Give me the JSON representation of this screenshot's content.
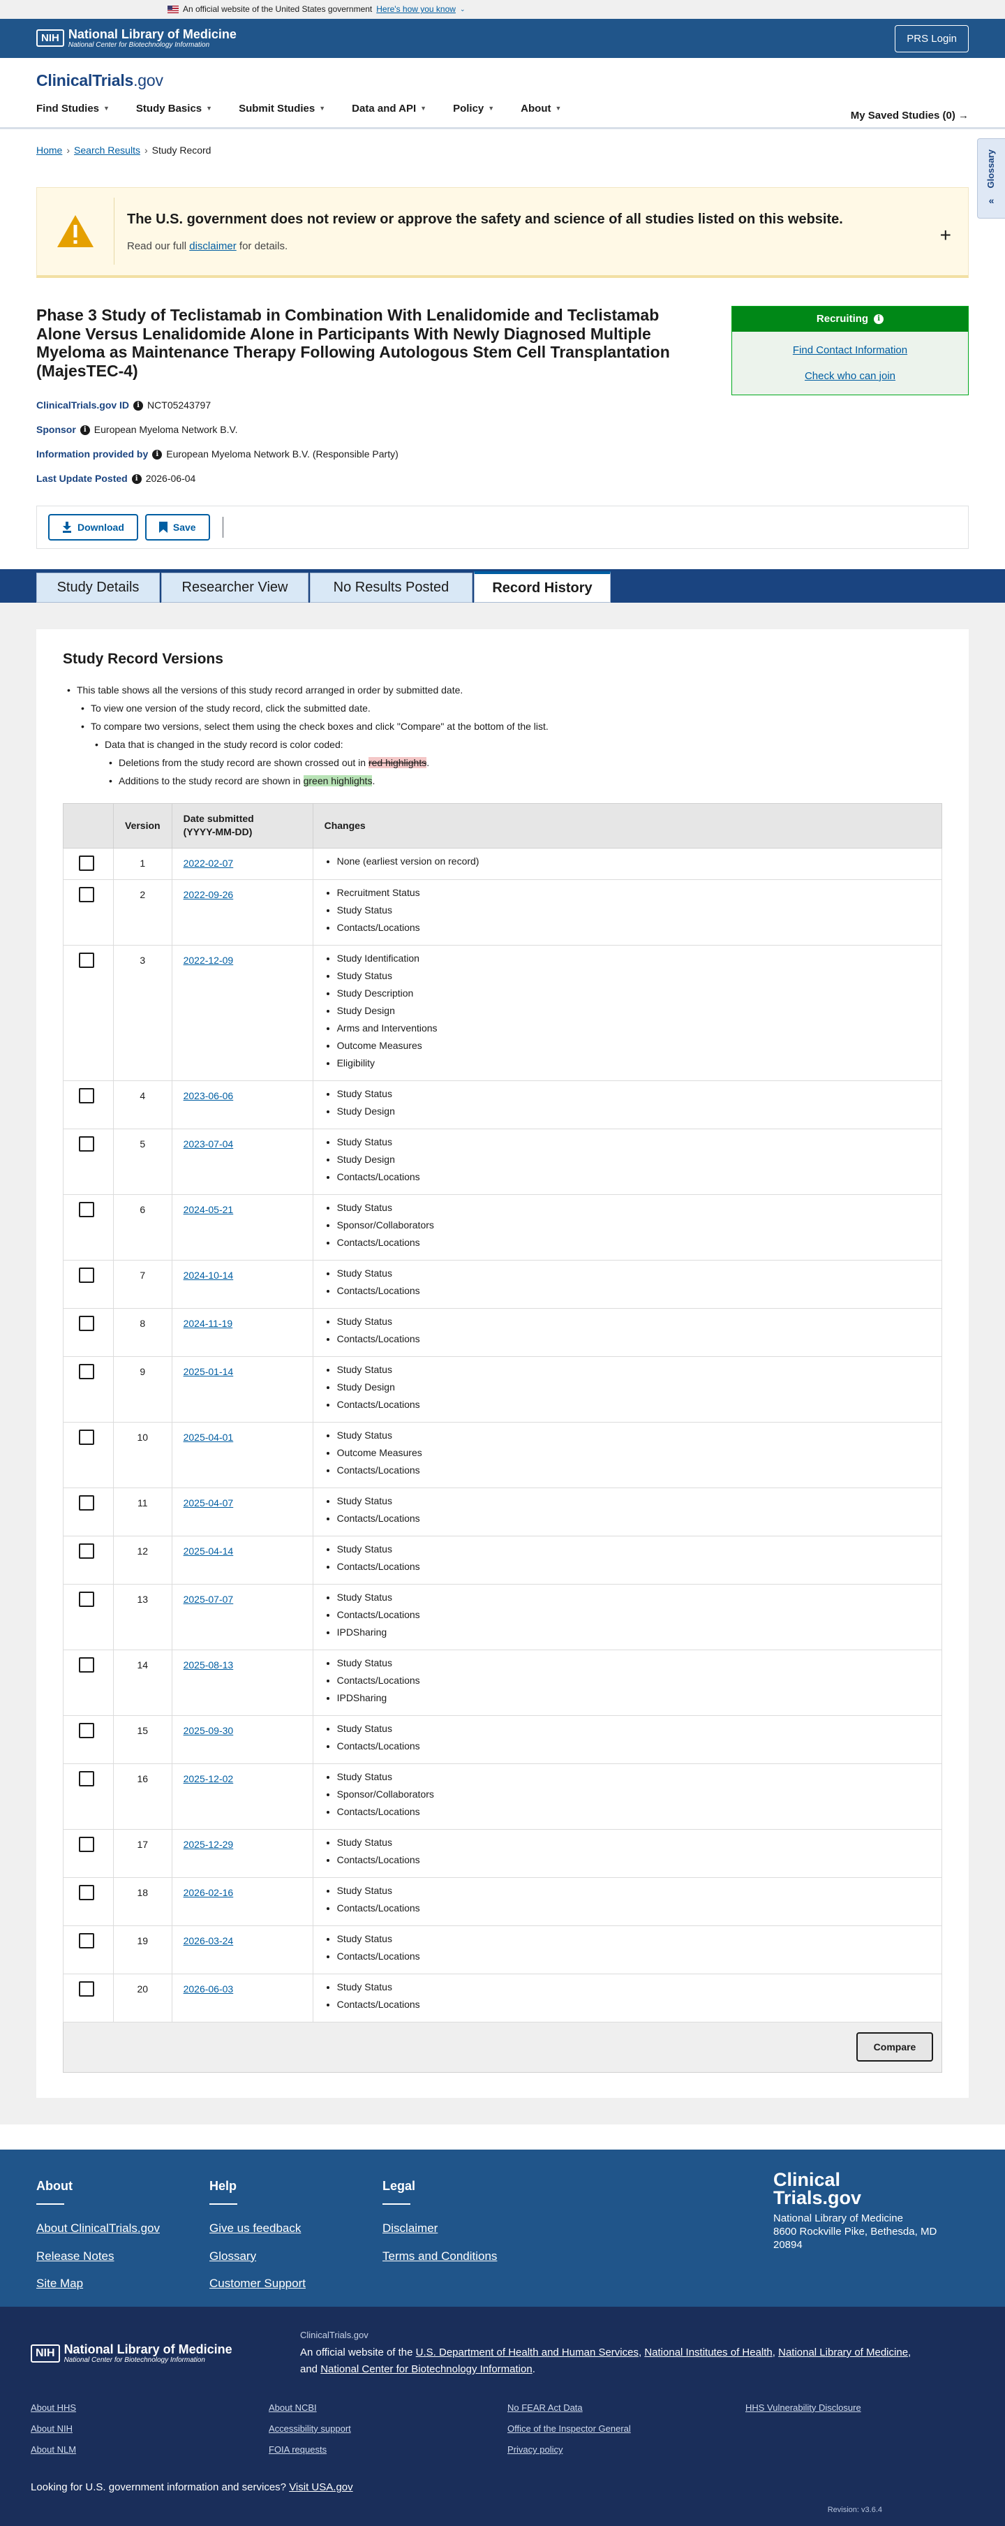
{
  "gov_banner": {
    "text": "An official website of the United States government",
    "link": "Here's how you know"
  },
  "nih_header": {
    "logo_box": "NIH",
    "org": "National Library of Medicine",
    "sub": "National Center for Biotechnology Information",
    "prs_login": "PRS Login"
  },
  "site": {
    "logo_main": "ClinicalTrials",
    "logo_suffix": ".gov",
    "nav": [
      "Find Studies",
      "Study Basics",
      "Submit Studies",
      "Data and API",
      "Policy",
      "About"
    ],
    "saved": "My Saved Studies (0)"
  },
  "glossary": "Glossary",
  "breadcrumb": {
    "home": "Home",
    "results": "Search Results",
    "current": "Study Record"
  },
  "alert": {
    "title": "The U.S. government does not review or approve the safety and science of all studies listed on this website.",
    "pre": "Read our full",
    "link": "disclaimer",
    "post": "for details."
  },
  "study": {
    "title": "Phase 3 Study of Teclistamab in Combination With Lenalidomide and Teclistamab Alone Versus Lenalidomide Alone in Participants With Newly Diagnosed Multiple Myeloma as Maintenance Therapy Following Autologous Stem Cell Transplantation (MajesTEC-4)",
    "id_label": "ClinicalTrials.gov ID",
    "id_value": "NCT05243797",
    "sponsor_label": "Sponsor",
    "sponsor_value": "European Myeloma Network B.V.",
    "info_label": "Information provided by",
    "info_value": "European Myeloma Network B.V. (Responsible Party)",
    "update_label": "Last Update Posted",
    "update_value": "2026-06-04"
  },
  "status": {
    "label": "Recruiting",
    "contact": "Find Contact Information",
    "join": "Check who can join"
  },
  "actions": {
    "download": "Download",
    "save": "Save"
  },
  "tabs": [
    "Study Details",
    "Researcher View",
    "No Results Posted",
    "Record History"
  ],
  "history": {
    "title": "Study Record Versions",
    "intro1": "This table shows all the versions of this study record arranged in order by submitted date.",
    "intro2": "To view one version of the study record, click the submitted date.",
    "intro3": "To compare two versions, select them using the check boxes and click \"Compare\" at the bottom of the list.",
    "intro4": "Data that is changed in the study record is color coded:",
    "del_pre": "Deletions from the study record are shown crossed out in",
    "del_hl": "red highlights",
    "add_pre": "Additions to the study record are shown in",
    "add_hl": "green highlights",
    "col_version": "Version",
    "col_date_1": "Date submitted",
    "col_date_2": "(YYYY-MM-DD)",
    "col_changes": "Changes",
    "compare": "Compare",
    "rows": [
      {
        "v": "1",
        "date": "2022-02-07",
        "changes": [
          "None (earliest version on record)"
        ]
      },
      {
        "v": "2",
        "date": "2022-09-26",
        "changes": [
          "Recruitment Status",
          "Study Status",
          "Contacts/Locations"
        ]
      },
      {
        "v": "3",
        "date": "2022-12-09",
        "changes": [
          "Study Identification",
          "Study Status",
          "Study Description",
          "Study Design",
          "Arms and Interventions",
          "Outcome Measures",
          "Eligibility"
        ]
      },
      {
        "v": "4",
        "date": "2023-06-06",
        "changes": [
          "Study Status",
          "Study Design"
        ]
      },
      {
        "v": "5",
        "date": "2023-07-04",
        "changes": [
          "Study Status",
          "Study Design",
          "Contacts/Locations"
        ]
      },
      {
        "v": "6",
        "date": "2024-05-21",
        "changes": [
          "Study Status",
          "Sponsor/Collaborators",
          "Contacts/Locations"
        ]
      },
      {
        "v": "7",
        "date": "2024-10-14",
        "changes": [
          "Study Status",
          "Contacts/Locations"
        ]
      },
      {
        "v": "8",
        "date": "2024-11-19",
        "changes": [
          "Study Status",
          "Contacts/Locations"
        ]
      },
      {
        "v": "9",
        "date": "2025-01-14",
        "changes": [
          "Study Status",
          "Study Design",
          "Contacts/Locations"
        ]
      },
      {
        "v": "10",
        "date": "2025-04-01",
        "changes": [
          "Study Status",
          "Outcome Measures",
          "Contacts/Locations"
        ]
      },
      {
        "v": "11",
        "date": "2025-04-07",
        "changes": [
          "Study Status",
          "Contacts/Locations"
        ]
      },
      {
        "v": "12",
        "date": "2025-04-14",
        "changes": [
          "Study Status",
          "Contacts/Locations"
        ]
      },
      {
        "v": "13",
        "date": "2025-07-07",
        "changes": [
          "Study Status",
          "Contacts/Locations",
          "IPDSharing"
        ]
      },
      {
        "v": "14",
        "date": "2025-08-13",
        "changes": [
          "Study Status",
          "Contacts/Locations",
          "IPDSharing"
        ]
      },
      {
        "v": "15",
        "date": "2025-09-30",
        "changes": [
          "Study Status",
          "Contacts/Locations"
        ]
      },
      {
        "v": "16",
        "date": "2025-12-02",
        "changes": [
          "Study Status",
          "Sponsor/Collaborators",
          "Contacts/Locations"
        ]
      },
      {
        "v": "17",
        "date": "2025-12-29",
        "changes": [
          "Study Status",
          "Contacts/Locations"
        ]
      },
      {
        "v": "18",
        "date": "2026-02-16",
        "changes": [
          "Study Status",
          "Contacts/Locations"
        ]
      },
      {
        "v": "19",
        "date": "2026-03-24",
        "changes": [
          "Study Status",
          "Contacts/Locations"
        ]
      },
      {
        "v": "20",
        "date": "2026-06-03",
        "changes": [
          "Study Status",
          "Contacts/Locations"
        ]
      }
    ]
  },
  "footer": {
    "about": {
      "title": "About",
      "links": [
        "About ClinicalTrials.gov",
        "Release Notes",
        "Site Map"
      ]
    },
    "help": {
      "title": "Help",
      "links": [
        "Give us feedback",
        "Glossary",
        "Customer Support"
      ]
    },
    "legal": {
      "title": "Legal",
      "links": [
        "Disclaimer",
        "Terms and Conditions"
      ]
    },
    "brand_1": "Clinical",
    "brand_2": "Trials.gov",
    "addr_1": "National Library of Medicine",
    "addr_2": "8600 Rockville Pike, Bethesda, MD",
    "addr_3": "20894",
    "nih_box": "NIH",
    "nih_org": "National Library of Medicine",
    "nih_sub": "National Center for Biotechnology Information",
    "site_small": "ClinicalTrials.gov",
    "official_pre": "An official website of the",
    "hhs": "U.S. Department of Health and Human Services",
    "nih": "National Institutes of Health",
    "nlm": "National Library of Medicine",
    "and": "and",
    "ncbi": "National Center for Biotechnology Information",
    "links": [
      "About HHS",
      "About NCBI",
      "No FEAR Act Data",
      "HHS Vulnerability Disclosure",
      "About NIH",
      "Accessibility support",
      "Office of the Inspector General",
      "",
      "About NLM",
      "FOIA requests",
      "Privacy policy",
      ""
    ],
    "usa_pre": "Looking for U.S. government information and services?",
    "usa_link": "Visit USA.gov",
    "version": "Revision: v3.6.4"
  }
}
